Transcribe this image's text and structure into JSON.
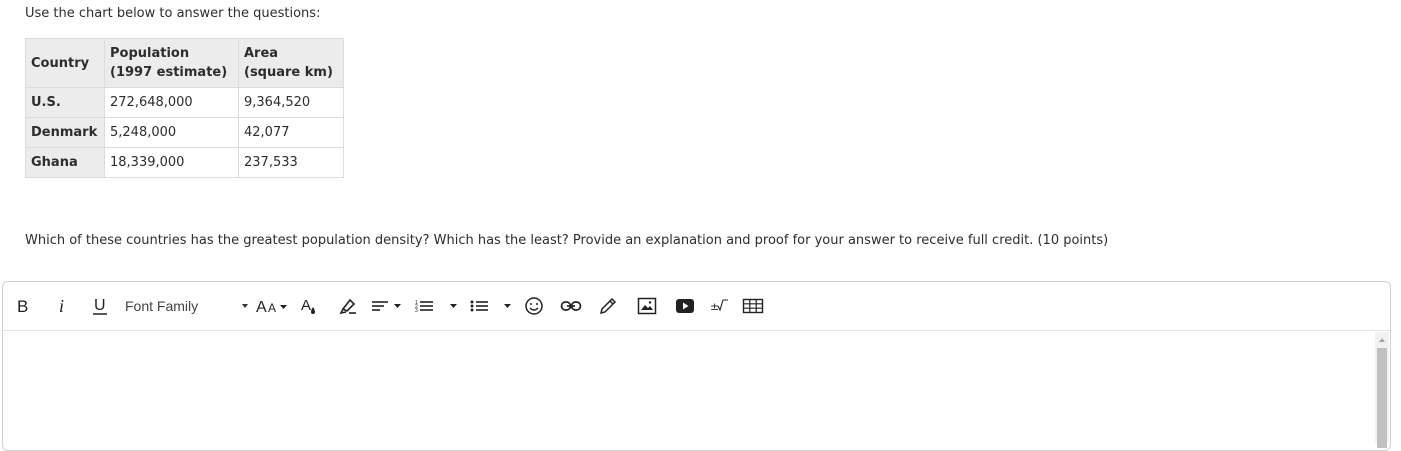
{
  "instructions": "Use the chart below to answer the questions:",
  "table": {
    "headers": {
      "country": "Country",
      "population_line1": "Population",
      "population_line2": "(1997 estimate)",
      "area_line1": "Area",
      "area_line2": "(square km)"
    },
    "rows": [
      {
        "country": "U.S.",
        "population": "272,648,000",
        "area": "9,364,520"
      },
      {
        "country": "Denmark",
        "population": "5,248,000",
        "area": "42,077"
      },
      {
        "country": "Ghana",
        "population": "18,339,000",
        "area": "237,533"
      }
    ]
  },
  "question": "Which of these countries has the greatest population density? Which has the least? Provide an explanation and proof for your answer to receive full credit. (10 points)",
  "editor": {
    "font_family_label": "Font Family",
    "toolbar_icons": [
      "bold-icon",
      "italic-icon",
      "underline-icon",
      "font-size-icon",
      "font-color-icon",
      "highlight-icon",
      "align-icon",
      "numbered-list-icon",
      "bullet-list-icon",
      "emoji-icon",
      "link-icon",
      "pencil-icon",
      "image-icon",
      "video-icon",
      "math-icon",
      "table-icon"
    ],
    "body_text": ""
  },
  "colors": {
    "header_bg": "#ececec",
    "border": "#dcdcdc",
    "text": "#2d2d2d"
  }
}
